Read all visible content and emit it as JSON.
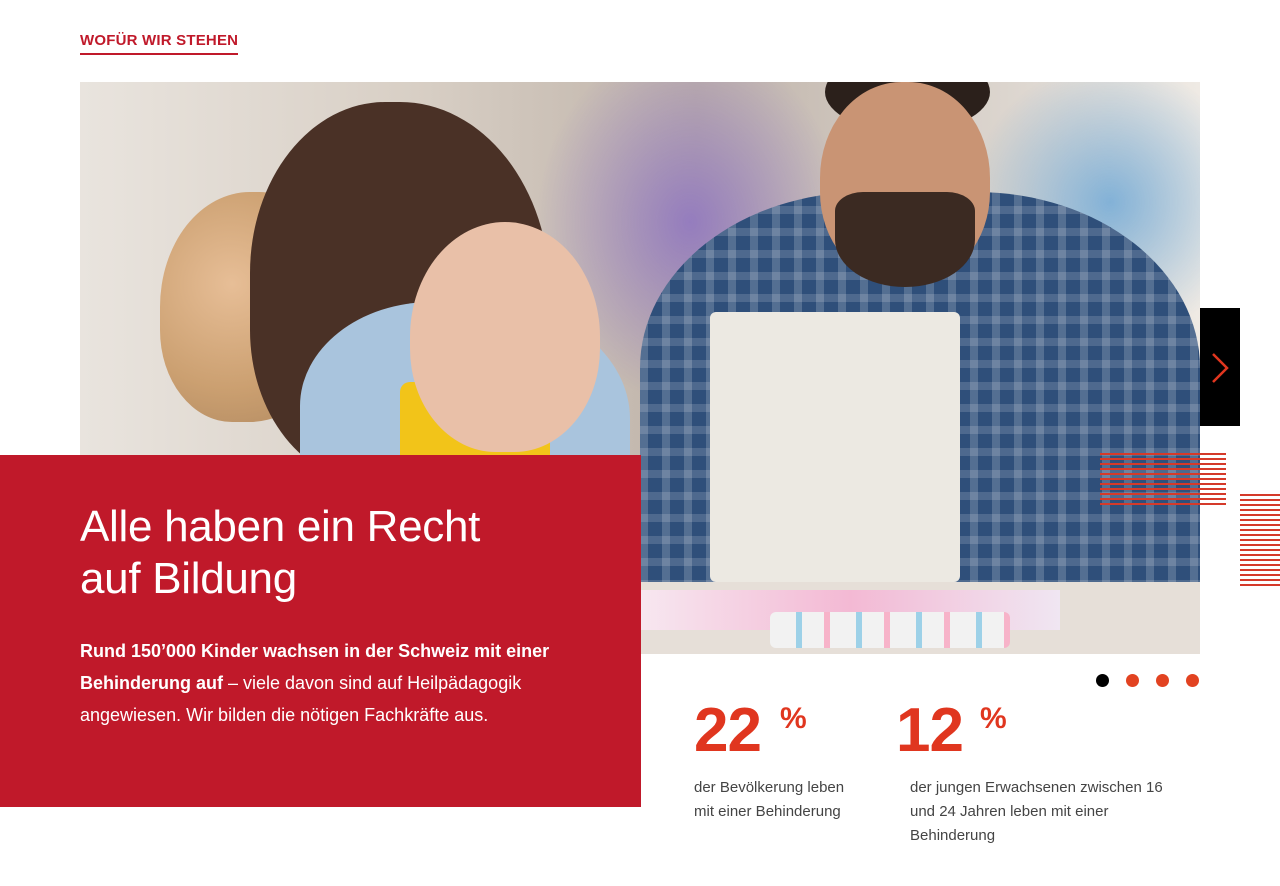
{
  "section": {
    "label": "WOFÜR WIR STEHEN"
  },
  "hero": {
    "image_name": "photo-girl-and-teacher-painting",
    "info": {
      "title_line1": "Alle haben ein Recht",
      "title_line2": "auf Bildung",
      "text_bold": "Rund 150’000 Kinder wachsen in der Schweiz mit einer Behinderung auf",
      "text_rest": " – viele davon sind auf Heilpädagogik angewiesen. Wir bilden die nötigen Fachkräfte aus."
    }
  },
  "slider": {
    "next_icon": "chevron-right-icon",
    "dots": [
      {
        "active": true
      },
      {
        "active": false
      },
      {
        "active": false
      },
      {
        "active": false
      }
    ]
  },
  "stats": [
    {
      "value": "22",
      "unit": "%",
      "line1": "der Bevölkerung leben",
      "line2": "mit einer Behinderung",
      "line3": ""
    },
    {
      "value": "12",
      "unit": "%",
      "line1": "der jungen Erwachsenen zwischen 16",
      "line2": "und 24 Jahren leben mit einer",
      "line3": "Behinderung"
    }
  ],
  "colors": {
    "brand_red": "#c0192a",
    "accent_orange": "#e0361f",
    "dot_active": "#000000"
  }
}
